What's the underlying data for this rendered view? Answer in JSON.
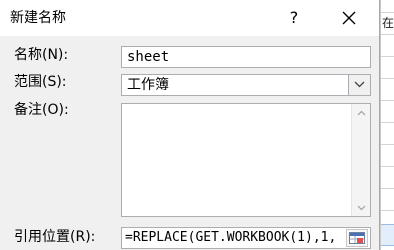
{
  "dialog": {
    "title": "新建名称",
    "help_label": "?",
    "close_icon": "close-icon"
  },
  "form": {
    "name_label": "名称(N):",
    "name_value": "sheet",
    "scope_label": "范围(S):",
    "scope_value": "工作簿",
    "comment_label": "备注(O):",
    "comment_value": "",
    "refers_to_label": "引用位置(R):",
    "refers_to_value": "=REPLACE(GET.WORKBOOK(1),1,"
  },
  "background": {
    "cell_text": "在"
  },
  "colors": {
    "dialog_bg": "#f0f0f0",
    "field_border": "#abadb3",
    "titlebar_bg": "#ffffff"
  }
}
